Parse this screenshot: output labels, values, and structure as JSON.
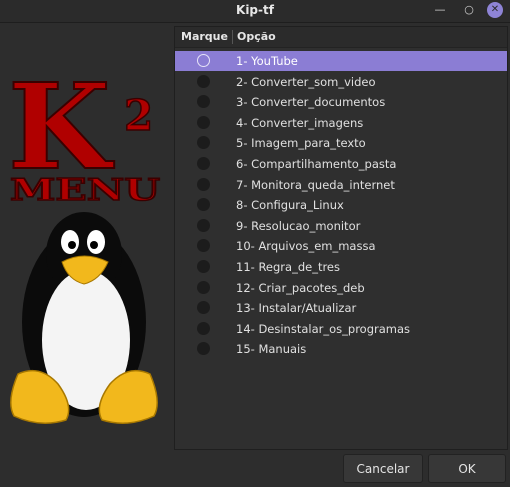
{
  "window": {
    "title": "Kip-tf"
  },
  "logo": {
    "text_main": "K",
    "text_sup": "2",
    "text_menu": "MENU"
  },
  "list": {
    "columns": [
      "Marque",
      "Opção"
    ],
    "items": [
      {
        "label": "1- YouTube",
        "selected": true
      },
      {
        "label": "2- Converter_som_video",
        "selected": false
      },
      {
        "label": "3- Converter_documentos",
        "selected": false
      },
      {
        "label": "4- Converter_imagens",
        "selected": false
      },
      {
        "label": "5- Imagem_para_texto",
        "selected": false
      },
      {
        "label": "6- Compartilhamento_pasta",
        "selected": false
      },
      {
        "label": "7- Monitora_queda_internet",
        "selected": false
      },
      {
        "label": "8- Configura_Linux",
        "selected": false
      },
      {
        "label": "9- Resolucao_monitor",
        "selected": false
      },
      {
        "label": "10- Arquivos_em_massa",
        "selected": false
      },
      {
        "label": "11- Regra_de_tres",
        "selected": false
      },
      {
        "label": "12- Criar_pacotes_deb",
        "selected": false
      },
      {
        "label": "13- Instalar/Atualizar",
        "selected": false
      },
      {
        "label": "14- Desinstalar_os_programas",
        "selected": false
      },
      {
        "label": "15- Manuais",
        "selected": false
      }
    ]
  },
  "buttons": {
    "cancel": "Cancelar",
    "ok": "OK"
  },
  "colors": {
    "selection": "#8b7dd4",
    "logo_red": "#b00000"
  }
}
